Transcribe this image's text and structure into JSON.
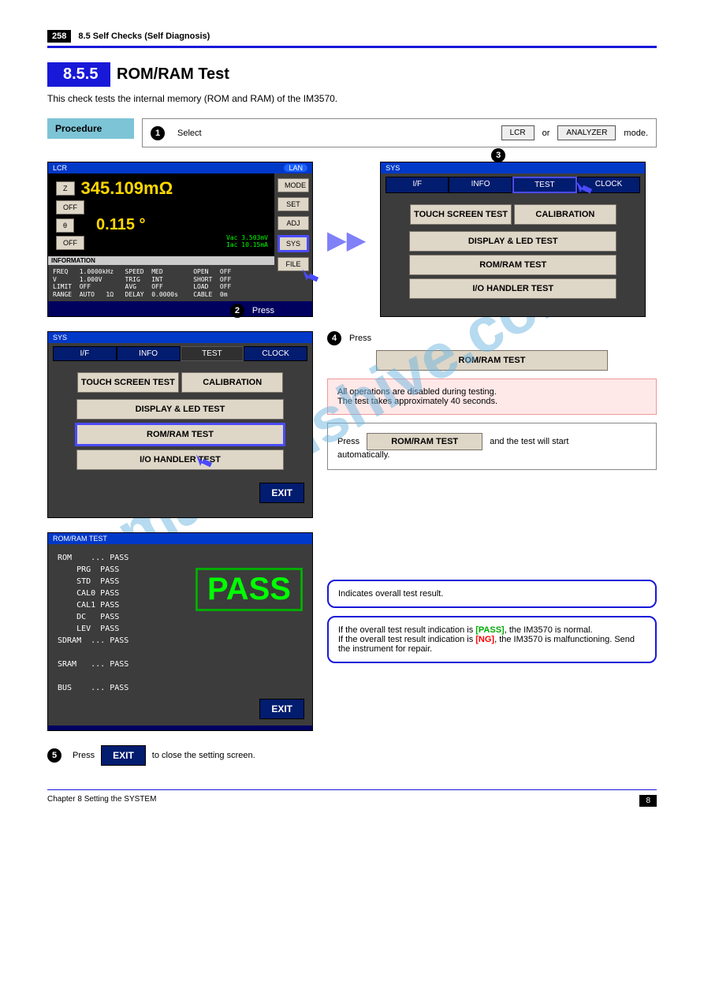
{
  "watermark": "manualshive.com",
  "breadcrumb": "8.5 Self Checks (Self Diagnosis)",
  "section": {
    "num": "8.5.5",
    "title": "ROM/RAM Test",
    "desc": "This check tests the internal memory (ROM and RAM) of the IM3570."
  },
  "procedure_label": "Procedure",
  "step_intro": "Select",
  "lcr": "LCR",
  "analyzer": "ANALYZER",
  "or": "or",
  "mode_text": "mode.",
  "shot1": {
    "tl": "LCR",
    "tr": "LAN",
    "z": "Z",
    "off": "OFF",
    "theta": "θ",
    "val1": "345.109mΩ",
    "val2": "0.115 °",
    "vac": "Vac  3.503mV",
    "iac": "Iac  10.15mA",
    "mode": "MODE",
    "set": "SET",
    "adj": "ADJ",
    "sys": "SYS",
    "file": "FILE",
    "info_hdr": "INFORMATION",
    "info": "FREQ   1.0000kHz   SPEED  MED        OPEN   OFF\nV      1.000V      TRIG   INT        SHORT  OFF\nLIMIT  OFF         AVG    OFF        LOAD   OFF\nRANGE  AUTO   1Ω   DELAY  0.0000s    CABLE  0m",
    "step": "2",
    "step_txt": "Press"
  },
  "shot2": {
    "tl": "SYS",
    "tabs": [
      "I/F",
      "INFO",
      "TEST",
      "CLOCK"
    ],
    "b1": "TOUCH SCREEN TEST",
    "b2": "CALIBRATION",
    "b3": "DISPLAY & LED TEST",
    "b4": "ROM/RAM TEST",
    "b5": "I/O HANDLER TEST",
    "step": "3",
    "step_txt": "Press"
  },
  "shot3": {
    "tl": "SYS",
    "tabs": [
      "I/F",
      "INFO",
      "TEST",
      "CLOCK"
    ],
    "b1": "TOUCH SCREEN TEST",
    "b2": "CALIBRATION",
    "b3": "DISPLAY & LED TEST",
    "b4": "ROM/RAM TEST",
    "b5": "I/O HANDLER TEST",
    "exit": "EXIT",
    "step": "4",
    "step_txt": "Press"
  },
  "right4": {
    "btn": "ROM/RAM TEST",
    "note": "All operations are disabled during testing.\nThe test takes approximately 40 seconds.",
    "info": "Press                                       and the test will start\nautomatically.",
    "info_btn": "ROM/RAM TEST"
  },
  "shot5": {
    "tl": "ROM/RAM TEST",
    "lines": "ROM    ... PASS\n    PRG  PASS\n    STD  PASS\n    CAL0 PASS\n    CAL1 PASS\n    DC   PASS\n    LEV  PASS\nSDRAM  ... PASS\n\nSRAM   ... PASS\n\nBUS    ... PASS",
    "pass": "PASS",
    "exit": "EXIT"
  },
  "result_text": "Indicates overall test result.",
  "pass_box": "If the overall test result indication is               , the IM3570 is nor-\nmal.\nIf the overall test result indication is             , the IM3570 is mal-\nfunctioning. Send the instrument for repair.",
  "pass_word": "[PASS]",
  "ng_word": "[NG]",
  "exit_step": {
    "num": "5",
    "text": "Press              to close the setting screen."
  },
  "exit_btn": "EXIT",
  "footer": {
    "left": "Chapter 8  Setting the SYSTEM",
    "right": "",
    "page": "258",
    "chap": "8"
  }
}
